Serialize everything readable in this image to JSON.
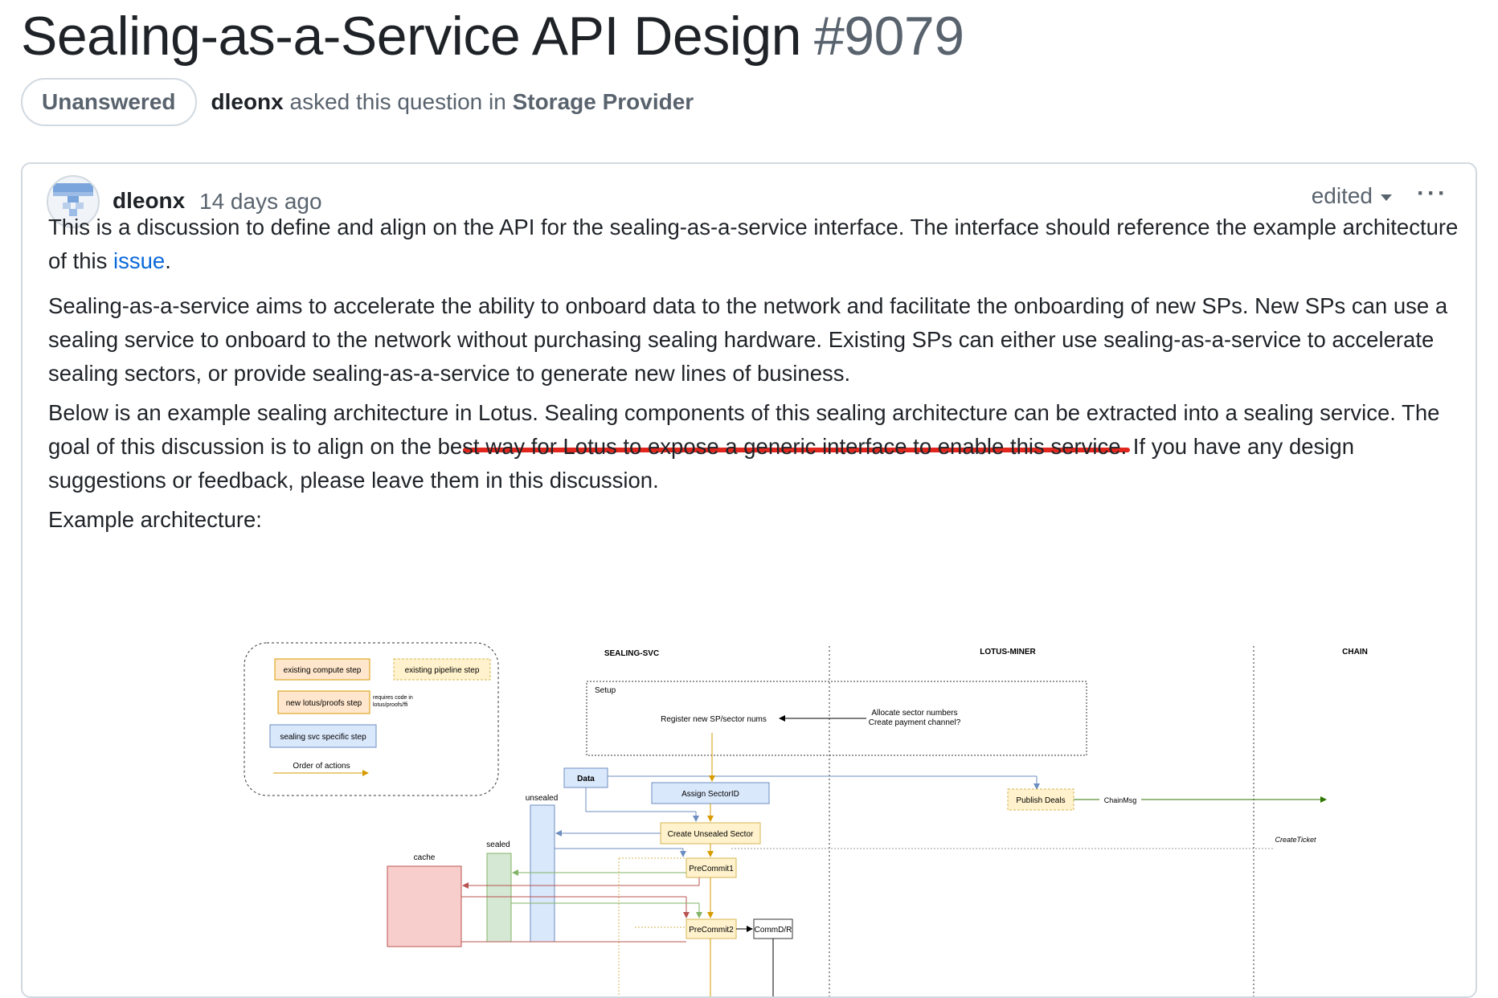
{
  "discussion": {
    "title": "Sealing-as-a-Service API Design",
    "number": "#9079",
    "status": "Unanswered",
    "author": "dleonx",
    "asked_text": "asked this question in",
    "category": "Storage Provider"
  },
  "post": {
    "author": "dleonx",
    "time": "14 days ago",
    "edited_label": "edited",
    "more_label": "···",
    "p1_before": "This is a discussion to define and align on the API for the sealing-as-a-service interface. The interface should reference the example architecture of this ",
    "p1_link": "issue",
    "p1_after": ".",
    "p2": "Sealing-as-a-service aims to accelerate the ability to onboard data to the network and facilitate the onboarding of new SPs. New SPs can use a sealing service to onboard to the network without purchasing sealing hardware. Existing SPs can either use sealing-as-a-service to accelerate sealing sectors, or provide sealing-as-a-service to generate new lines of business.",
    "p3": "Below is an example sealing architecture in Lotus. Sealing components of this sealing architecture can be extracted into a sealing service. The goal of this discussion is to align on the best way for Lotus to expose a generic interface to enable this service. If you have any design suggestions or feedback, please leave them in this discussion.",
    "p4": "Example architecture:"
  },
  "diagram": {
    "lanes": [
      "SEALING-SVC",
      "LOTUS-MINER",
      "CHAIN"
    ],
    "legend": {
      "existing_compute": "existing compute step",
      "existing_pipeline": "existing pipeline step",
      "new_lotus": "new lotus/proofs step",
      "requires_code_1": "requires code in",
      "requires_code_2": "lotus/proofs/ffi",
      "svc_specific": "sealing svc specific step",
      "order": "Order of actions"
    },
    "setup_label": "Setup",
    "register": "Register new SP/sector nums",
    "allocate_1": "Allocate sector numbers",
    "allocate_2": "Create payment channel?",
    "data": "Data",
    "assign": "Assign SectorID",
    "publish": "Publish Deals",
    "chainmsg": "ChainMsg",
    "create_unsealed": "Create Unsealed Sector",
    "create_ticket": "CreateTicket",
    "unsealed": "unsealed",
    "sealed": "sealed",
    "cache": "cache",
    "precommit1": "PreCommit1",
    "precommit2": "PreCommit2",
    "commdr": "CommD/R"
  }
}
